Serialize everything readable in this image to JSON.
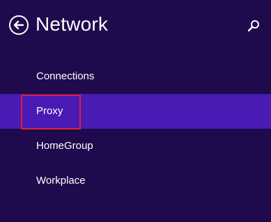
{
  "header": {
    "title": "Network",
    "back_icon": "back-arrow-icon",
    "search_icon": "search-icon"
  },
  "nav": {
    "items": [
      {
        "label": "Connections",
        "selected": false
      },
      {
        "label": "Proxy",
        "selected": true
      },
      {
        "label": "HomeGroup",
        "selected": false
      },
      {
        "label": "Workplace",
        "selected": false
      }
    ]
  },
  "colors": {
    "background": "#1e0a4d",
    "selected": "#4a1ab4",
    "highlight": "#e0202e",
    "text": "#ffffff"
  }
}
